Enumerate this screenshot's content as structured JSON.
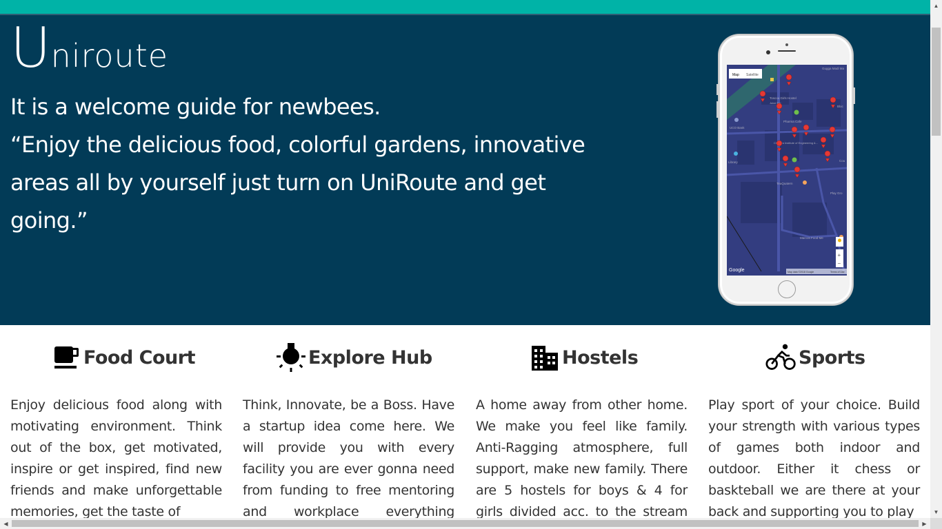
{
  "colors": {
    "topbar": "#00b3a7",
    "hero_bg": "#023b57",
    "text_dark": "#333333"
  },
  "hero": {
    "brand_initial": "U",
    "brand_rest": "niroute",
    "tagline_line1": "It is a welcome guide for newbees.",
    "tagline_quote": "“Enjoy the delicious food, colorful gardens, innovative areas all by yourself just turn on UniRoute and get going.”"
  },
  "phone_map": {
    "tab_map": "Map",
    "tab_satellite": "Satellite",
    "labels": [
      "Gugga Madi Ma",
      "Toscoa Girls Hostel",
      "Juice Bar",
      "Pharma Cafe",
      "UCO Bank",
      "Chitkara Institute of Engineering &...",
      "Bloc",
      "Cou",
      "Library",
      "TeaQuatern",
      "Play Gro",
      "Marcos Food Me",
      "Google",
      "Map data ©2018 Google",
      "Terms of Use"
    ],
    "zoom_in": "+",
    "zoom_out": "−"
  },
  "features": [
    {
      "icon": "coffee-cup-icon",
      "title": "Food Court",
      "body": "Enjoy delicious food along with motivating environment. Think out of the box, get motivated, inspire or get inspired, find new friends and make unforgettable memories, get the taste of"
    },
    {
      "icon": "lightbulb-icon",
      "title": "Explore Hub",
      "body": "Think, Innovate, be a Boss. Have a startup idea come here. We will provide you with every facility you are ever gonna need from funding to free mentoring and workplace everything settled for"
    },
    {
      "icon": "building-icon",
      "title": "Hostels",
      "body": "A home away from other home. We make you feel like family. Anti-Ragging atmosphere, full support, make new family. There are 5 hostels for boys & 4 for girls divided acc. to the stream you are"
    },
    {
      "icon": "bicycle-icon",
      "title": "Sports",
      "body": "Play sport of your choice. Build your strength with various types of games both indoor and outdoor. Either it chess or baskteball we are there at your back and supporting you to play"
    }
  ]
}
